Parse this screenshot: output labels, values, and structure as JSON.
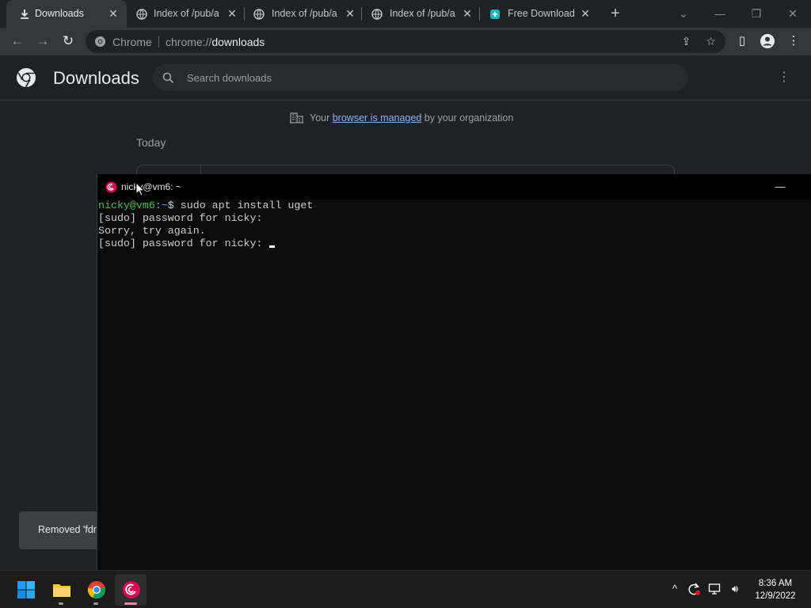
{
  "browser": {
    "tabs": [
      {
        "label": "Downloads",
        "active": true,
        "icon": "download-icon"
      },
      {
        "label": "Index of /pub/a",
        "active": false,
        "icon": "globe-icon"
      },
      {
        "label": "Index of /pub/a",
        "active": false,
        "icon": "globe-icon"
      },
      {
        "label": "Index of /pub/a",
        "active": false,
        "icon": "globe-icon"
      },
      {
        "label": "Free Download",
        "active": false,
        "icon": "free-download-icon"
      }
    ],
    "omnibox": {
      "chip": "Chrome",
      "url_scheme": "chrome://",
      "url_path": "downloads"
    }
  },
  "downloads_page": {
    "title": "Downloads",
    "search_placeholder": "Search downloads",
    "managed_prefix": "Your ",
    "managed_link": "browser is managed",
    "managed_suffix": " by your organization",
    "date_group": "Today",
    "toast_text": "Removed 'fdr"
  },
  "terminal": {
    "title": "nicky@vm6: ~",
    "prompt_user": "nicky@vm6",
    "prompt_path": ":~",
    "prompt_symbol": "$",
    "command": " sudo apt install uget",
    "lines": [
      "[sudo] password for nicky:",
      "Sorry, try again.",
      "[sudo] password for nicky: "
    ]
  },
  "taskbar": {
    "apps": [
      "start-icon",
      "file-explorer-icon",
      "chrome-icon",
      "debian-terminal-icon"
    ],
    "time": "8:36 AM",
    "date": "12/9/2022"
  },
  "colors": {
    "chrome_bg": "#202124",
    "toolbar_bg": "#35363a",
    "link": "#8ab4f8",
    "prompt_user": "#4dbb55",
    "prompt_path": "#6e9fe0",
    "debian": "#d70a53"
  }
}
